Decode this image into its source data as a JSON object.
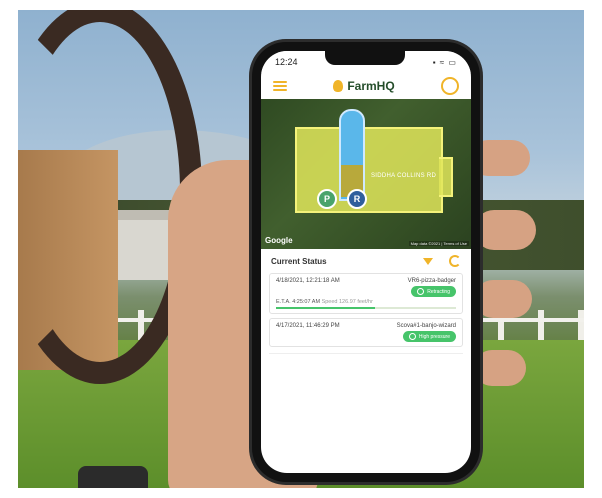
{
  "phone": {
    "status_time": "12:24",
    "status_icons": "▪ ≈ ▭",
    "app": {
      "brand": "FarmHQ"
    },
    "map": {
      "field_name": "SIDDHA COLLINS RD",
      "pins": [
        {
          "label": "P"
        },
        {
          "label": "R"
        }
      ],
      "google_label": "Google",
      "attribution": "Map data ©2021 | Terms of Use"
    },
    "current_status": {
      "title": "Current Status",
      "entries": [
        {
          "timestamp": "4/18/2021, 12:21:18 AM",
          "device": "VR6-pizza-badger",
          "badge": "Retracting",
          "eta_label": "E.T.A. 4:25:07 AM",
          "speed_label": "Speed 126.97 feet/hr",
          "progress": 0.55
        },
        {
          "timestamp": "4/17/2021, 11:46:29 PM",
          "device": "Scova#1-banjo-wizard",
          "badge": "High pressure"
        }
      ]
    }
  },
  "colors": {
    "accent": "#f0b429",
    "success": "#46c46a",
    "zone": "#5ab7ea",
    "field": "#e1e65a"
  }
}
